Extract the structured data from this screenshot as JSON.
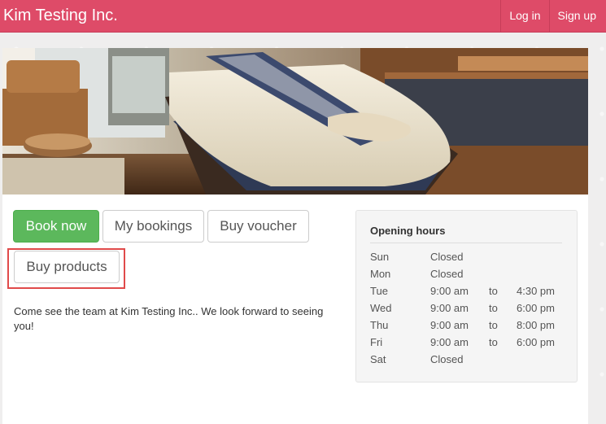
{
  "navbar": {
    "brand": "Kim Testing Inc.",
    "login": "Log in",
    "signup": "Sign up",
    "color": "#de4b68"
  },
  "actions": {
    "book_now": "Book now",
    "my_bookings": "My bookings",
    "buy_voucher": "Buy voucher",
    "buy_products": "Buy products"
  },
  "intro_text": "Come see the team at Kim Testing Inc.. We look forward to seeing you!",
  "opening_hours": {
    "title": "Opening hours",
    "days": [
      {
        "day": "Sun",
        "open": "Closed",
        "to": "",
        "close": ""
      },
      {
        "day": "Mon",
        "open": "Closed",
        "to": "",
        "close": ""
      },
      {
        "day": "Tue",
        "open": "9:00 am",
        "to": "to",
        "close": "4:30 pm"
      },
      {
        "day": "Wed",
        "open": "9:00 am",
        "to": "to",
        "close": "6:00 pm"
      },
      {
        "day": "Thu",
        "open": "9:00 am",
        "to": "to",
        "close": "8:00 pm"
      },
      {
        "day": "Fri",
        "open": "9:00 am",
        "to": "to",
        "close": "6:00 pm"
      },
      {
        "day": "Sat",
        "open": "Closed",
        "to": "",
        "close": ""
      }
    ]
  },
  "colors": {
    "primary_button": "#5cb85c",
    "highlight": "#e04a4a"
  }
}
